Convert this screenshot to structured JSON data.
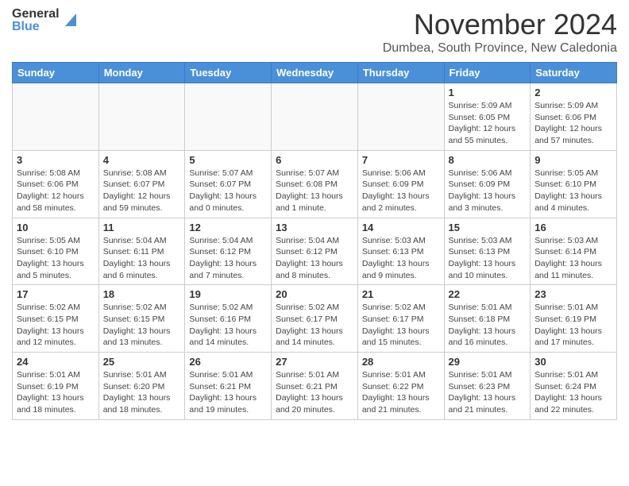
{
  "header": {
    "logo_general": "General",
    "logo_blue": "Blue",
    "month_year": "November 2024",
    "location": "Dumbea, South Province, New Caledonia"
  },
  "weekdays": [
    "Sunday",
    "Monday",
    "Tuesday",
    "Wednesday",
    "Thursday",
    "Friday",
    "Saturday"
  ],
  "weeks": [
    [
      {
        "day": "",
        "info": ""
      },
      {
        "day": "",
        "info": ""
      },
      {
        "day": "",
        "info": ""
      },
      {
        "day": "",
        "info": ""
      },
      {
        "day": "",
        "info": ""
      },
      {
        "day": "1",
        "info": "Sunrise: 5:09 AM\nSunset: 6:05 PM\nDaylight: 12 hours\nand 55 minutes."
      },
      {
        "day": "2",
        "info": "Sunrise: 5:09 AM\nSunset: 6:06 PM\nDaylight: 12 hours\nand 57 minutes."
      }
    ],
    [
      {
        "day": "3",
        "info": "Sunrise: 5:08 AM\nSunset: 6:06 PM\nDaylight: 12 hours\nand 58 minutes."
      },
      {
        "day": "4",
        "info": "Sunrise: 5:08 AM\nSunset: 6:07 PM\nDaylight: 12 hours\nand 59 minutes."
      },
      {
        "day": "5",
        "info": "Sunrise: 5:07 AM\nSunset: 6:07 PM\nDaylight: 13 hours\nand 0 minutes."
      },
      {
        "day": "6",
        "info": "Sunrise: 5:07 AM\nSunset: 6:08 PM\nDaylight: 13 hours\nand 1 minute."
      },
      {
        "day": "7",
        "info": "Sunrise: 5:06 AM\nSunset: 6:09 PM\nDaylight: 13 hours\nand 2 minutes."
      },
      {
        "day": "8",
        "info": "Sunrise: 5:06 AM\nSunset: 6:09 PM\nDaylight: 13 hours\nand 3 minutes."
      },
      {
        "day": "9",
        "info": "Sunrise: 5:05 AM\nSunset: 6:10 PM\nDaylight: 13 hours\nand 4 minutes."
      }
    ],
    [
      {
        "day": "10",
        "info": "Sunrise: 5:05 AM\nSunset: 6:10 PM\nDaylight: 13 hours\nand 5 minutes."
      },
      {
        "day": "11",
        "info": "Sunrise: 5:04 AM\nSunset: 6:11 PM\nDaylight: 13 hours\nand 6 minutes."
      },
      {
        "day": "12",
        "info": "Sunrise: 5:04 AM\nSunset: 6:12 PM\nDaylight: 13 hours\nand 7 minutes."
      },
      {
        "day": "13",
        "info": "Sunrise: 5:04 AM\nSunset: 6:12 PM\nDaylight: 13 hours\nand 8 minutes."
      },
      {
        "day": "14",
        "info": "Sunrise: 5:03 AM\nSunset: 6:13 PM\nDaylight: 13 hours\nand 9 minutes."
      },
      {
        "day": "15",
        "info": "Sunrise: 5:03 AM\nSunset: 6:13 PM\nDaylight: 13 hours\nand 10 minutes."
      },
      {
        "day": "16",
        "info": "Sunrise: 5:03 AM\nSunset: 6:14 PM\nDaylight: 13 hours\nand 11 minutes."
      }
    ],
    [
      {
        "day": "17",
        "info": "Sunrise: 5:02 AM\nSunset: 6:15 PM\nDaylight: 13 hours\nand 12 minutes."
      },
      {
        "day": "18",
        "info": "Sunrise: 5:02 AM\nSunset: 6:15 PM\nDaylight: 13 hours\nand 13 minutes."
      },
      {
        "day": "19",
        "info": "Sunrise: 5:02 AM\nSunset: 6:16 PM\nDaylight: 13 hours\nand 14 minutes."
      },
      {
        "day": "20",
        "info": "Sunrise: 5:02 AM\nSunset: 6:17 PM\nDaylight: 13 hours\nand 14 minutes."
      },
      {
        "day": "21",
        "info": "Sunrise: 5:02 AM\nSunset: 6:17 PM\nDaylight: 13 hours\nand 15 minutes."
      },
      {
        "day": "22",
        "info": "Sunrise: 5:01 AM\nSunset: 6:18 PM\nDaylight: 13 hours\nand 16 minutes."
      },
      {
        "day": "23",
        "info": "Sunrise: 5:01 AM\nSunset: 6:19 PM\nDaylight: 13 hours\nand 17 minutes."
      }
    ],
    [
      {
        "day": "24",
        "info": "Sunrise: 5:01 AM\nSunset: 6:19 PM\nDaylight: 13 hours\nand 18 minutes."
      },
      {
        "day": "25",
        "info": "Sunrise: 5:01 AM\nSunset: 6:20 PM\nDaylight: 13 hours\nand 18 minutes."
      },
      {
        "day": "26",
        "info": "Sunrise: 5:01 AM\nSunset: 6:21 PM\nDaylight: 13 hours\nand 19 minutes."
      },
      {
        "day": "27",
        "info": "Sunrise: 5:01 AM\nSunset: 6:21 PM\nDaylight: 13 hours\nand 20 minutes."
      },
      {
        "day": "28",
        "info": "Sunrise: 5:01 AM\nSunset: 6:22 PM\nDaylight: 13 hours\nand 21 minutes."
      },
      {
        "day": "29",
        "info": "Sunrise: 5:01 AM\nSunset: 6:23 PM\nDaylight: 13 hours\nand 21 minutes."
      },
      {
        "day": "30",
        "info": "Sunrise: 5:01 AM\nSunset: 6:24 PM\nDaylight: 13 hours\nand 22 minutes."
      }
    ]
  ]
}
